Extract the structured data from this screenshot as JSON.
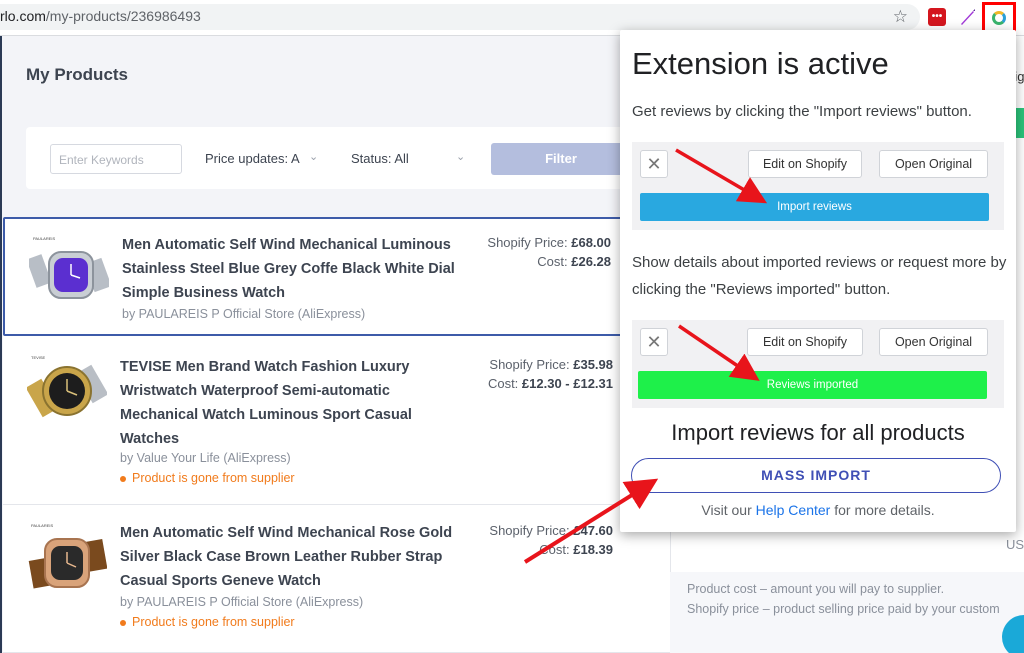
{
  "browser": {
    "url_domain": "rlo.com",
    "url_path": "/my-products/236986493"
  },
  "page": {
    "title": "My Products"
  },
  "filters": {
    "keyword_placeholder": "Enter Keywords",
    "price_updates_label": "Price updates: A",
    "status_label": "Status: All",
    "filter_button": "Filter"
  },
  "products": [
    {
      "title_lines": [
        "Men Automatic Self Wind Mechanical Luminous",
        "Stainless Steel Blue Grey Coffe Black White Dial",
        "Simple Business Watch"
      ],
      "store": "by PAULAREIS P Official Store (AliExpress)",
      "shopify_price_label": "Shopify Price:",
      "shopify_price": "£68.00",
      "cost_label": "Cost:",
      "cost": "£26.28",
      "gone": ""
    },
    {
      "title_lines": [
        "TEVISE Men Brand Watch Fashion Luxury",
        "Wristwatch Waterproof Semi-automatic",
        "Mechanical Watch Luminous Sport Casual",
        "Watches"
      ],
      "store": "by Value Your Life (AliExpress)",
      "shopify_price_label": "Shopify Price:",
      "shopify_price": "£35.98",
      "cost_label": "Cost:",
      "cost": "£12.30 - £12.31",
      "gone": "Product is gone from supplier"
    },
    {
      "title_lines": [
        "Men Automatic Self Wind Mechanical Rose Gold",
        "Silver Black Case Brown Leather Rubber Strap",
        "Casual Sports Geneve Watch"
      ],
      "store": "by PAULAREIS P Official Store (AliExpress)",
      "shopify_price_label": "Shopify Price:",
      "shopify_price": "£47.60",
      "cost_label": "Cost:",
      "cost": "£18.39",
      "gone": "Product is gone from supplier"
    }
  ],
  "right_panel": {
    "info_line_1": "Product cost – amount you will pay to supplier.",
    "info_line_2": "Shopify price – product selling price paid by your custom",
    "frag_rig": "rig",
    "frag_us": "US"
  },
  "popup": {
    "title": "Extension is active",
    "text_1": "Get reviews by clicking the \"Import reviews\" button.",
    "demo_edit": "Edit on Shopify",
    "demo_open": "Open Original",
    "demo_import": "Import reviews",
    "text_2": "Show details about imported reviews or request more by clicking the \"Reviews imported\" button.",
    "demo_imported": "Reviews imported",
    "heading": "Import reviews for all products",
    "mass_import": "MASS IMPORT",
    "foot_before": "Visit our",
    "foot_link": "Help Center",
    "foot_after": "for more details."
  },
  "colors": {
    "import_blue": "#29a8e0",
    "imported_green": "#1ef04a",
    "mass_border": "#3f4fb5",
    "arrow_red": "#e8141b"
  }
}
